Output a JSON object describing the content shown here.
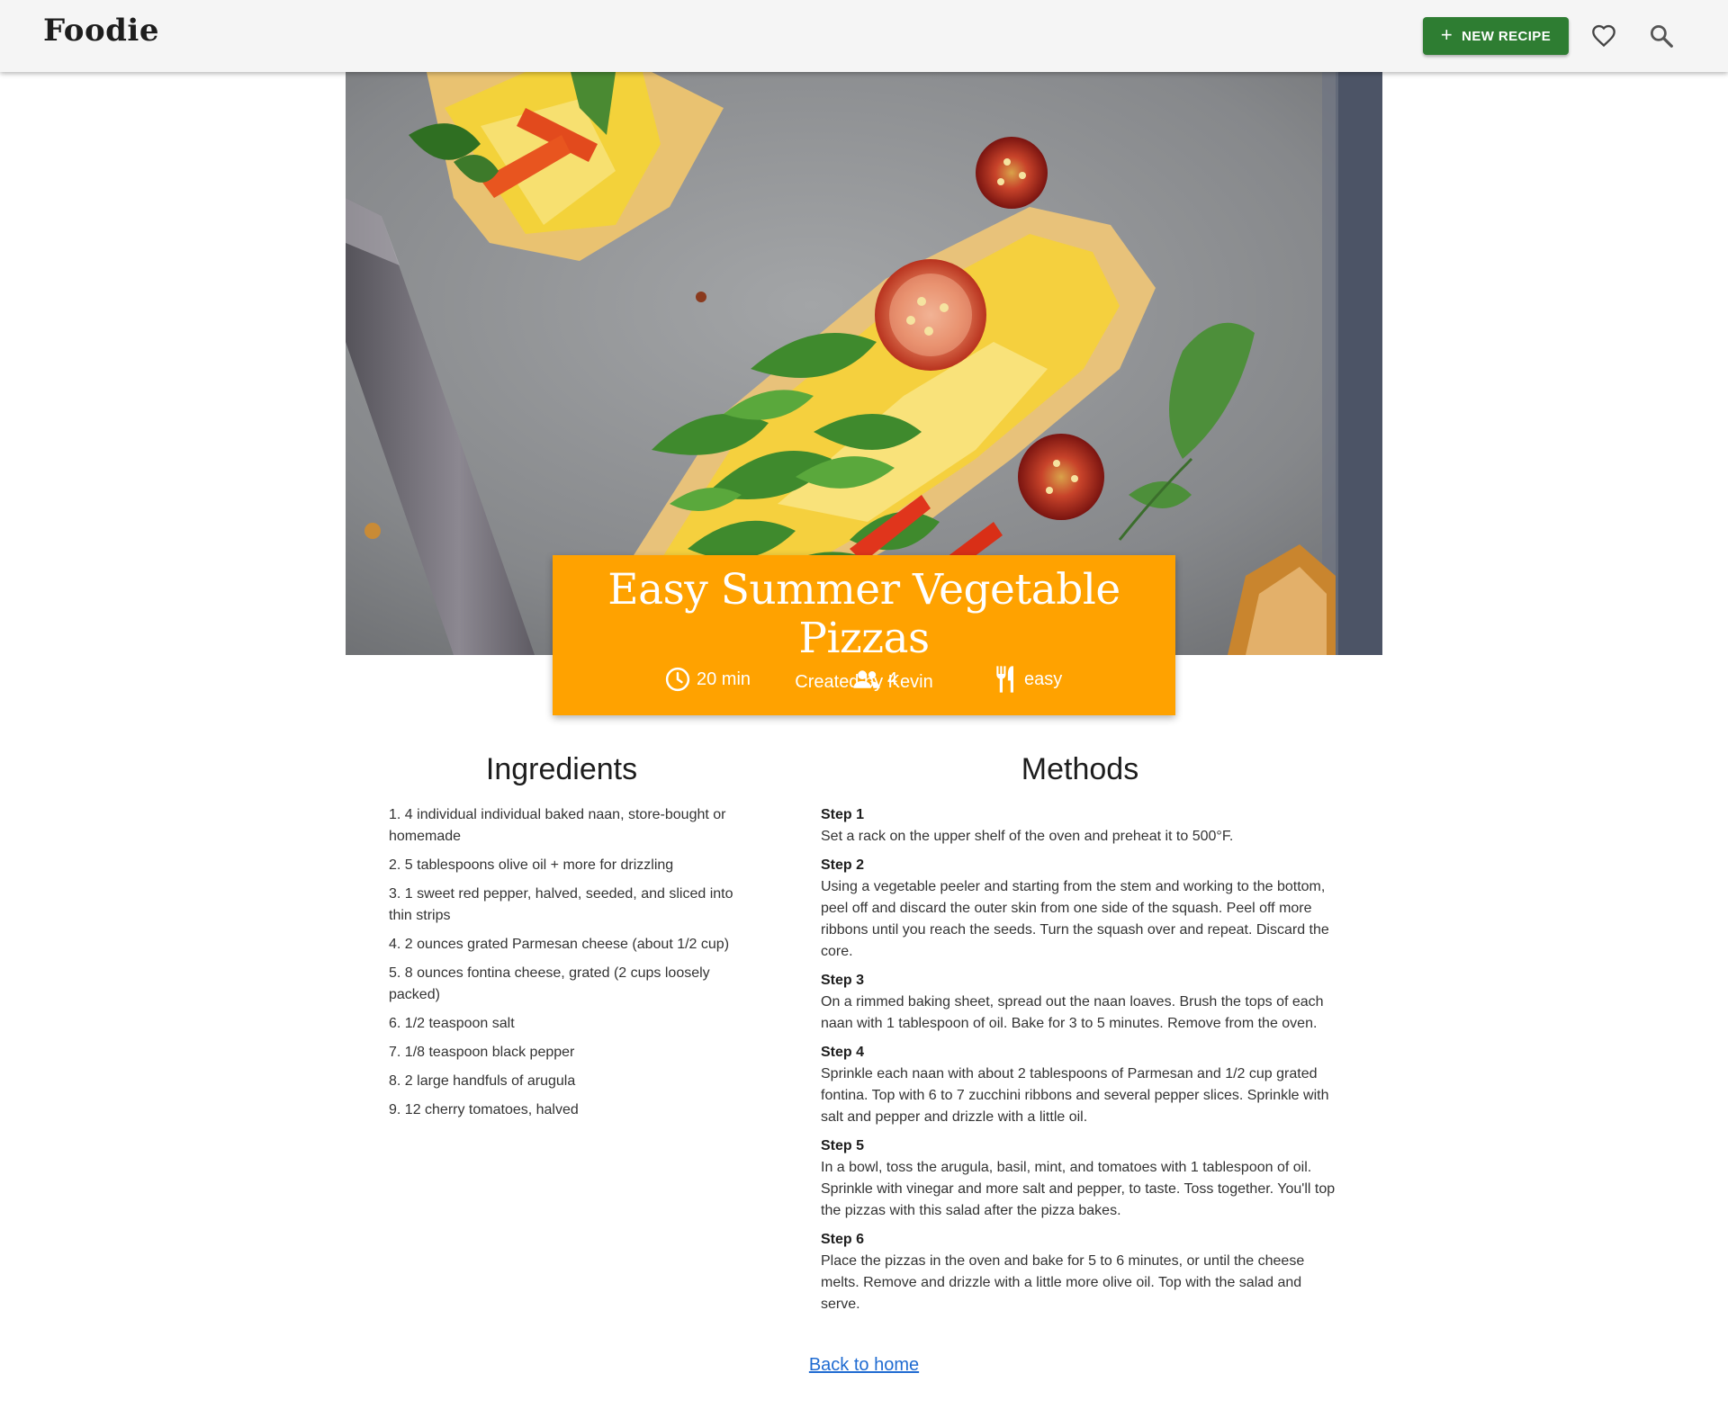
{
  "header": {
    "brand": "Foodie",
    "new_recipe_label": "NEW RECIPE",
    "favorites_icon": "heart-outline-icon",
    "search_icon": "search-icon",
    "accent_color": "#2e7d32"
  },
  "recipe": {
    "title": "Easy Summer Vegetable Pizzas",
    "author": "Created by Kevin",
    "time": "20 min",
    "servings": "4",
    "difficulty": "easy",
    "card_color": "#ffa200"
  },
  "ingredients": {
    "heading": "Ingredients",
    "items": [
      "1.  4 individual individual baked naan, store-bought or homemade",
      "2.  5 tablespoons olive oil + more for drizzling",
      "3.  1 sweet red pepper, halved, seeded, and sliced into thin strips",
      "4.  2 ounces grated Parmesan cheese (about 1/2 cup)",
      "5.  8 ounces fontina cheese, grated (2 cups loosely packed)",
      "6.  1/2 teaspoon  salt",
      "7.  1/8 teaspoon black pepper",
      "8.  2 large handfuls of arugula",
      "9.  12 cherry tomatoes, halved"
    ]
  },
  "methods": {
    "heading": "Methods",
    "steps": [
      {
        "label": "Step 1",
        "text": "Set a rack on the upper shelf of the oven and preheat it to 500°F."
      },
      {
        "label": "Step 2",
        "text": "Using a vegetable peeler and starting from the stem and working to the bottom, peel off and discard the outer skin from one side of the squash. Peel off more ribbons until you reach the seeds. Turn the squash over and repeat. Discard the core."
      },
      {
        "label": "Step 3",
        "text": "On a rimmed baking sheet, spread out the naan loaves. Brush the tops of each naan with 1 tablespoon of oil. Bake for 3 to 5 minutes. Remove from the oven."
      },
      {
        "label": "Step 4",
        "text": "Sprinkle each naan with about 2 tablespoons of Parmesan and 1/2 cup grated fontina. Top with 6 to 7 zucchini ribbons and several pepper slices. Sprinkle with salt and pepper and drizzle with a little oil."
      },
      {
        "label": "Step 5",
        "text": "In a bowl, toss the arugula, basil, mint, and tomatoes with 1 tablespoon of oil. Sprinkle with vinegar and more salt and pepper, to taste. Toss together. You'll top the pizzas with this salad after the pizza bakes."
      },
      {
        "label": "Step 6",
        "text": "Place the pizzas in the oven and bake for 5 to 6 minutes, or until the cheese melts. Remove and drizzle with a little more olive oil. Top with the salad and serve."
      }
    ]
  },
  "footer": {
    "back_link": "Back to home"
  }
}
